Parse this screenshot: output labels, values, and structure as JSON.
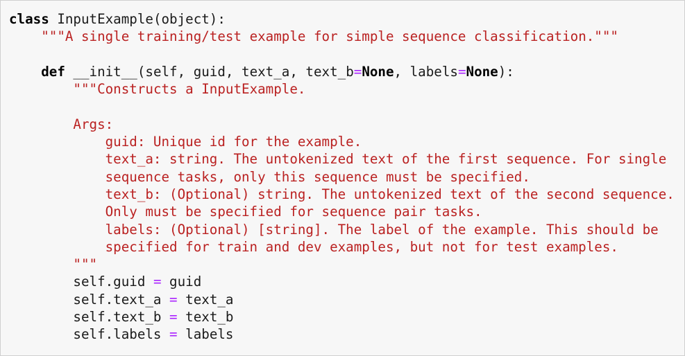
{
  "code": {
    "lines": [
      [
        {
          "t": "class",
          "c": "kw"
        },
        {
          "t": " InputExample(object):",
          "c": "plain"
        }
      ],
      [
        {
          "t": "    ",
          "c": "plain"
        },
        {
          "t": "\"\"\"A single training/test example for simple sequence classification.\"\"\"",
          "c": "str"
        }
      ],
      [
        {
          "t": "",
          "c": "plain"
        }
      ],
      [
        {
          "t": "    ",
          "c": "plain"
        },
        {
          "t": "def",
          "c": "kw"
        },
        {
          "t": " __init__(self, guid, text_a, text_b",
          "c": "plain"
        },
        {
          "t": "=",
          "c": "op"
        },
        {
          "t": "None",
          "c": "kw"
        },
        {
          "t": ", labels",
          "c": "plain"
        },
        {
          "t": "=",
          "c": "op"
        },
        {
          "t": "None",
          "c": "kw"
        },
        {
          "t": "):",
          "c": "plain"
        }
      ],
      [
        {
          "t": "        ",
          "c": "plain"
        },
        {
          "t": "\"\"\"Constructs a InputExample.",
          "c": "str"
        }
      ],
      [
        {
          "t": "",
          "c": "plain"
        }
      ],
      [
        {
          "t": "        ",
          "c": "plain"
        },
        {
          "t": "Args:",
          "c": "str"
        }
      ],
      [
        {
          "t": "            ",
          "c": "plain"
        },
        {
          "t": "guid: Unique id for the example.",
          "c": "str"
        }
      ],
      [
        {
          "t": "            ",
          "c": "plain"
        },
        {
          "t": "text_a: string. The untokenized text of the first sequence. For single",
          "c": "str"
        }
      ],
      [
        {
          "t": "            ",
          "c": "plain"
        },
        {
          "t": "sequence tasks, only this sequence must be specified.",
          "c": "str"
        }
      ],
      [
        {
          "t": "            ",
          "c": "plain"
        },
        {
          "t": "text_b: (Optional) string. The untokenized text of the second sequence.",
          "c": "str"
        }
      ],
      [
        {
          "t": "            ",
          "c": "plain"
        },
        {
          "t": "Only must be specified for sequence pair tasks.",
          "c": "str"
        }
      ],
      [
        {
          "t": "            ",
          "c": "plain"
        },
        {
          "t": "labels: (Optional) [string]. The label of the example. This should be",
          "c": "str"
        }
      ],
      [
        {
          "t": "            ",
          "c": "plain"
        },
        {
          "t": "specified for train and dev examples, but not for test examples.",
          "c": "str"
        }
      ],
      [
        {
          "t": "        ",
          "c": "plain"
        },
        {
          "t": "\"\"\"",
          "c": "str"
        }
      ],
      [
        {
          "t": "        self.guid ",
          "c": "plain"
        },
        {
          "t": "=",
          "c": "op"
        },
        {
          "t": " guid",
          "c": "plain"
        }
      ],
      [
        {
          "t": "        self.text_a ",
          "c": "plain"
        },
        {
          "t": "=",
          "c": "op"
        },
        {
          "t": " text_a",
          "c": "plain"
        }
      ],
      [
        {
          "t": "        self.text_b ",
          "c": "plain"
        },
        {
          "t": "=",
          "c": "op"
        },
        {
          "t": " text_b",
          "c": "plain"
        }
      ],
      [
        {
          "t": "        self.labels ",
          "c": "plain"
        },
        {
          "t": "=",
          "c": "op"
        },
        {
          "t": " labels",
          "c": "plain"
        }
      ]
    ]
  }
}
